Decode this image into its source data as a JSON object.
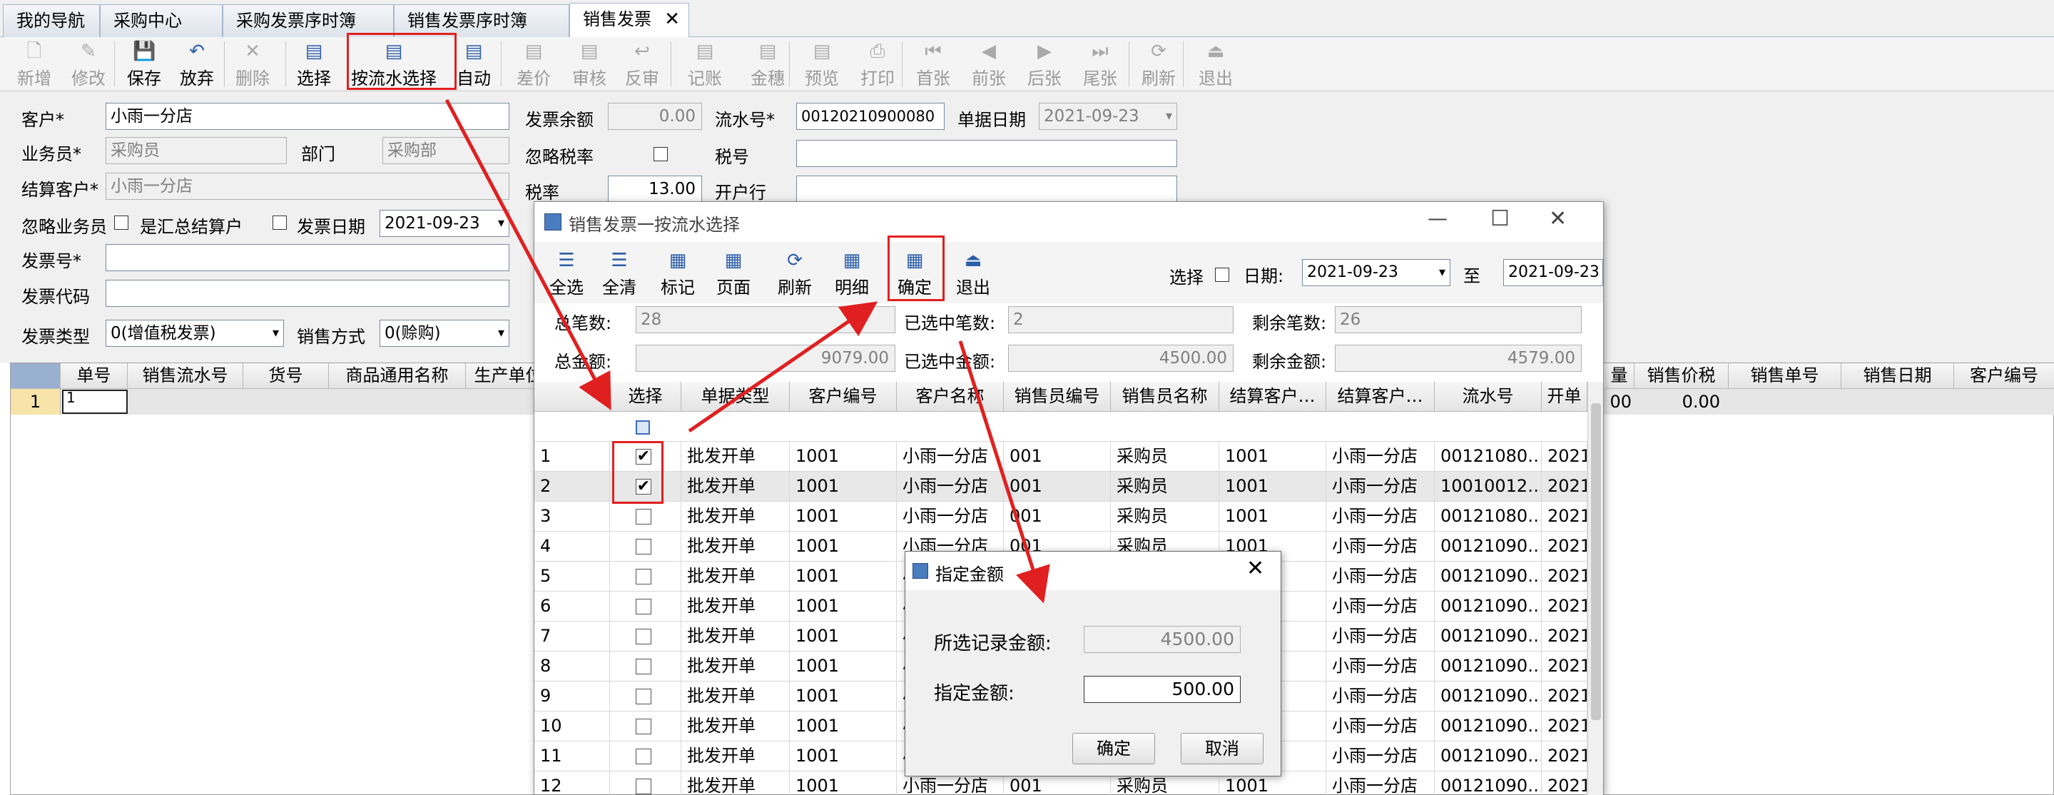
{
  "tabs": [
    {
      "label": "我的导航"
    },
    {
      "label": "采购中心"
    },
    {
      "label": "采购发票序时簿"
    },
    {
      "label": "销售发票序时簿"
    },
    {
      "label": "销售发票",
      "close": "✕"
    }
  ],
  "toolbar": [
    {
      "label": "新增",
      "icon": "new-icon",
      "disabled": true
    },
    {
      "label": "修改",
      "icon": "edit-icon",
      "disabled": true
    },
    {
      "label": "保存",
      "icon": "save-icon",
      "disabled": false
    },
    {
      "label": "放弃",
      "icon": "undo-icon",
      "disabled": false
    },
    {
      "label": "删除",
      "icon": "delete-icon",
      "disabled": true
    },
    {
      "label": "选择",
      "icon": "select-icon",
      "disabled": false
    },
    {
      "label": "按流水选择",
      "icon": "select-by-serial-icon",
      "disabled": false
    },
    {
      "label": "自动",
      "icon": "auto-icon",
      "disabled": false
    },
    {
      "label": "差价",
      "icon": "price-diff-icon",
      "disabled": true
    },
    {
      "label": "审核",
      "icon": "audit-icon",
      "disabled": true
    },
    {
      "label": "反审",
      "icon": "unaudit-icon",
      "disabled": true
    },
    {
      "label": "记账",
      "icon": "post-icon",
      "disabled": true
    },
    {
      "label": "金穗",
      "icon": "jinsui-icon",
      "disabled": true
    },
    {
      "label": "预览",
      "icon": "preview-icon",
      "disabled": true
    },
    {
      "label": "打印",
      "icon": "print-icon",
      "disabled": true
    },
    {
      "label": "首张",
      "icon": "first-icon",
      "disabled": true
    },
    {
      "label": "前张",
      "icon": "prev-icon",
      "disabled": true
    },
    {
      "label": "后张",
      "icon": "next-icon",
      "disabled": true
    },
    {
      "label": "尾张",
      "icon": "last-icon",
      "disabled": true
    },
    {
      "label": "刷新",
      "icon": "refresh-icon",
      "disabled": true
    },
    {
      "label": "退出",
      "icon": "exit-icon",
      "disabled": true
    }
  ],
  "form": {
    "customer_label": "客户*",
    "customer_value": "小雨一分店",
    "salesman_label": "业务员*",
    "salesman_value": "采购员",
    "dept_label": "部门",
    "dept_value": "采购部",
    "settle_label": "结算客户*",
    "settle_value": "小雨一分店",
    "ignore_salesman_label": "忽略业务员",
    "is_summary_label": "是汇总结算户",
    "invoice_date_label": "发票日期",
    "invoice_date_value": "2021-09-23",
    "invoice_no_label": "发票号*",
    "invoice_code_label": "发票代码",
    "invoice_type_label": "发票类型",
    "invoice_type_value": "0(增值税发票)",
    "sale_mode_label": "销售方式",
    "sale_mode_value": "0(赊购)",
    "balance_label": "发票余额",
    "balance_value": "0.00",
    "ignore_tax_label": "忽略税率",
    "tax_rate_label": "税率",
    "tax_rate_value": "13.00",
    "serial_label": "流水号*",
    "serial_value": "00120210900080",
    "doc_date_label": "单据日期",
    "doc_date_value": "2021-09-23",
    "tax_no_label": "税号",
    "bank_label": "开户行"
  },
  "main_grid": {
    "headers": [
      "单号",
      "销售流水号",
      "货号",
      "商品通用名称",
      "生产单位"
    ],
    "right_headers": [
      "量",
      "销售价税",
      "销售单号",
      "销售日期",
      "客户编号"
    ],
    "row": {
      "num": "1",
      "first": "1",
      "amount1": "00",
      "amount2": "0.00"
    }
  },
  "dialog": {
    "title": "销售发票一按流水选择",
    "controls": {
      "min": "—",
      "max": "☐",
      "close": "✕"
    },
    "toolbar": [
      {
        "label": "全选",
        "icon": "select-all-icon"
      },
      {
        "label": "全清",
        "icon": "clear-all-icon"
      },
      {
        "label": "标记",
        "icon": "mark-icon"
      },
      {
        "label": "页面",
        "icon": "page-icon"
      },
      {
        "label": "刷新",
        "icon": "refresh-icon"
      },
      {
        "label": "明细",
        "icon": "detail-icon"
      },
      {
        "label": "确定",
        "icon": "confirm-icon"
      },
      {
        "label": "退出",
        "icon": "exit-icon"
      }
    ],
    "select_label": "选择",
    "date_label": "日期:",
    "date_from": "2021-09-23",
    "to_label": "至",
    "date_to": "2021-09-23",
    "total_count_label": "总笔数:",
    "total_count": "28",
    "selected_count_label": "已选中笔数:",
    "selected_count": "2",
    "remain_count_label": "剩余笔数:",
    "remain_count": "26",
    "total_amount_label": "总金额:",
    "total_amount": "9079.00",
    "selected_amount_label": "已选中金额:",
    "selected_amount": "4500.00",
    "remain_amount_label": "剩余金额:",
    "remain_amount": "4579.00",
    "headers": [
      "选择",
      "单据类型",
      "客户编号",
      "客户名称",
      "销售员编号",
      "销售员名称",
      "结算客户…",
      "结算客户…",
      "流水号",
      "开单"
    ],
    "rows": [
      {
        "n": "1",
        "checked": true,
        "type": "批发开单",
        "cno": "1001",
        "cname": "小雨一分店",
        "sno": "001",
        "sname": "采购员",
        "set1": "1001",
        "set2": "小雨一分店",
        "serial": "00121080…",
        "date": "2021-"
      },
      {
        "n": "2",
        "checked": true,
        "type": "批发开单",
        "cno": "1001",
        "cname": "小雨一分店",
        "sno": "001",
        "sname": "采购员",
        "set1": "1001",
        "set2": "小雨一分店",
        "serial": "10010012…",
        "date": "2021-"
      },
      {
        "n": "3",
        "checked": false,
        "type": "批发开单",
        "cno": "1001",
        "cname": "小雨一分店",
        "sno": "001",
        "sname": "采购员",
        "set1": "1001",
        "set2": "小雨一分店",
        "serial": "00121080…",
        "date": "2021-"
      },
      {
        "n": "4",
        "checked": false,
        "type": "批发开单",
        "cno": "1001",
        "cname": "小雨一分店",
        "sno": "001",
        "sname": "采购员",
        "set1": "1001",
        "set2": "小雨一分店",
        "serial": "00121090…",
        "date": "2021-"
      },
      {
        "n": "5",
        "checked": false,
        "type": "批发开单",
        "cno": "1001",
        "cname": "小",
        "sno": "",
        "sname": "",
        "set1": "",
        "set2": "小雨一分店",
        "serial": "00121090…",
        "date": "2021-"
      },
      {
        "n": "6",
        "checked": false,
        "type": "批发开单",
        "cno": "1001",
        "cname": "小",
        "sno": "",
        "sname": "",
        "set1": "",
        "set2": "小雨一分店",
        "serial": "00121090…",
        "date": "2021-"
      },
      {
        "n": "7",
        "checked": false,
        "type": "批发开单",
        "cno": "1001",
        "cname": "小",
        "sno": "",
        "sname": "",
        "set1": "",
        "set2": "小雨一分店",
        "serial": "00121090…",
        "date": "2021-"
      },
      {
        "n": "8",
        "checked": false,
        "type": "批发开单",
        "cno": "1001",
        "cname": "小",
        "sno": "",
        "sname": "",
        "set1": "",
        "set2": "小雨一分店",
        "serial": "00121090…",
        "date": "2021-"
      },
      {
        "n": "9",
        "checked": false,
        "type": "批发开单",
        "cno": "1001",
        "cname": "小",
        "sno": "",
        "sname": "",
        "set1": "",
        "set2": "小雨一分店",
        "serial": "00121090…",
        "date": "2021-"
      },
      {
        "n": "10",
        "checked": false,
        "type": "批发开单",
        "cno": "1001",
        "cname": "小",
        "sno": "",
        "sname": "",
        "set1": "",
        "set2": "小雨一分店",
        "serial": "00121090…",
        "date": "2021-"
      },
      {
        "n": "11",
        "checked": false,
        "type": "批发开单",
        "cno": "1001",
        "cname": "小",
        "sno": "",
        "sname": "",
        "set1": "",
        "set2": "小雨一分店",
        "serial": "00121090…",
        "date": "2021-"
      },
      {
        "n": "12",
        "checked": false,
        "type": "批发开单",
        "cno": "1001",
        "cname": "小雨一分店",
        "sno": "001",
        "sname": "采购员",
        "set1": "1001",
        "set2": "小雨一分店",
        "serial": "00121090…",
        "date": "2021-"
      }
    ]
  },
  "amount_dialog": {
    "title": "指定金额",
    "close": "✕",
    "selected_label": "所选记录金额:",
    "selected_value": "4500.00",
    "specified_label": "指定金额:",
    "specified_value": "500.00",
    "ok": "确定",
    "cancel": "取消"
  },
  "colors": {
    "annotation_red": "#e02020",
    "selected_row": "#c8d8f0",
    "grid_header": "#e8e8e8"
  }
}
